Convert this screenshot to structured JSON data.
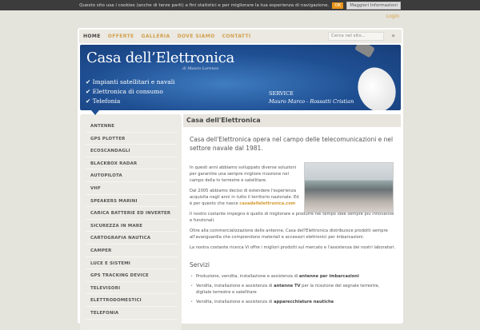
{
  "cookie": {
    "text": "Questo sito usa i cookies (anche di terze parti) a fini statistici e per migliorare la tua esperienza di navigazione.",
    "ok": "OK",
    "more": "Maggiori Informazioni"
  },
  "login": "Login",
  "nav": [
    "HOME",
    "OFFERTE",
    "GALLERIA",
    "DOVE SIAMO",
    "CONTATTI"
  ],
  "search": {
    "placeholder": "Cerca nel sito...",
    "button": "»"
  },
  "banner": {
    "title": "Casa dell’Elettronica",
    "subtitle": "di Mauro Lorenzo",
    "bullets": [
      "Impianti satellitari e navali",
      "Elettronica di consumo",
      "Telefonia"
    ],
    "service_label": "SERVICE",
    "service_names": "Mauro Marco - Rossatti Cristian"
  },
  "sidebar": [
    "ANTENNE",
    "GPS PLOTTER",
    "ECOSCANDAGLI",
    "BLACKBOX RADAR",
    "AUTOPILOTA",
    "VHF",
    "SPEAKERS MARINI",
    "CARICA BATTERIE ED INVERTER",
    "SICUREZZA IN MARE",
    "CARTOGRAFIA NAUTICA",
    "CAMPER",
    "LUCE E SISTEMI",
    "GPS TRACKING DEVICE",
    "TELEVISORI",
    "ELETTRODOMESTICI",
    "TELEFONIA"
  ],
  "content": {
    "heading": "Casa dell'Elettronica",
    "lead": "Casa dell'Elettronica opera nel campo delle telecomunicazioni e nel settore navale dal 1981.",
    "p1": "In questi anni abbiamo sviluppato diverse soluzioni per garantire una sempre migliore ricezione nel campo della tv terrestre e satellitare.",
    "p2": "Dal 2005 abbiamo deciso di estendere l'esperienza acquisita negli anni in tutto il territorio nazionale. Ed è per questo che nasce",
    "p2_link": "casadellelettronica.com",
    "p3": "Il nostro costante impegno è quello di migliorare e produrre nel tempo idee sempre più innovative e funzionali.",
    "p4": "Oltre alla commercializzazione delle antenne, Casa dell'Elettronica distribuisce prodotti sempre all'avanguardia che comprendono materiali e accessori elettronici per imbarcazioni.",
    "p5": "La nostra costante ricerca Vi offre i migliori prodotti sul mercato e l'assistenza dei nostri laboratori.",
    "services_title": "Servizi",
    "services": [
      {
        "pre": "Produzione, vendita, installazione e assistenza di ",
        "bold": "antenne per imbarcazioni",
        "post": ""
      },
      {
        "pre": "Vendita, installazione e assistenza di ",
        "bold": "antenne TV",
        "post": " per la ricezione del segnale terrestre, digitale terrestre e satellitare"
      },
      {
        "pre": "Vendita, installazione e assistenza di ",
        "bold": "apparecchiature nautiche",
        "post": ""
      }
    ]
  }
}
